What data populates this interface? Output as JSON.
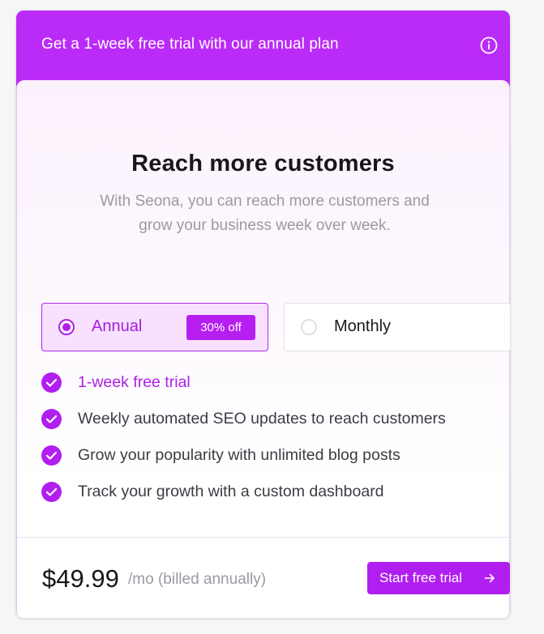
{
  "banner": {
    "text": "Get a 1-week free trial with our annual plan",
    "icon": "info-icon"
  },
  "heading": {
    "title": "Reach more customers",
    "subtitle": "With Seona, you can reach more customers and grow your business week over week."
  },
  "plans": [
    {
      "label": "Annual",
      "selected": true,
      "badge": "30% off"
    },
    {
      "label": "Monthly",
      "selected": false
    }
  ],
  "features": [
    {
      "text": "1-week free trial",
      "highlight": true,
      "icon": "check-icon"
    },
    {
      "text": "Weekly automated SEO updates to reach customers",
      "highlight": false,
      "icon": "check-icon"
    },
    {
      "text": "Grow your popularity with unlimited blog posts",
      "highlight": false,
      "icon": "check-icon"
    },
    {
      "text": "Track your growth with a custom dashboard",
      "highlight": false,
      "icon": "check-icon"
    }
  ],
  "footer": {
    "price": "$49.99",
    "price_suffix": "/mo (billed annually)",
    "cta_label": "Start free trial",
    "cta_icon": "arrow-right-icon"
  },
  "colors": {
    "accent": "#b01ff0",
    "banner": "#bb2bf7",
    "selected_bg": "#f8e1fe"
  }
}
